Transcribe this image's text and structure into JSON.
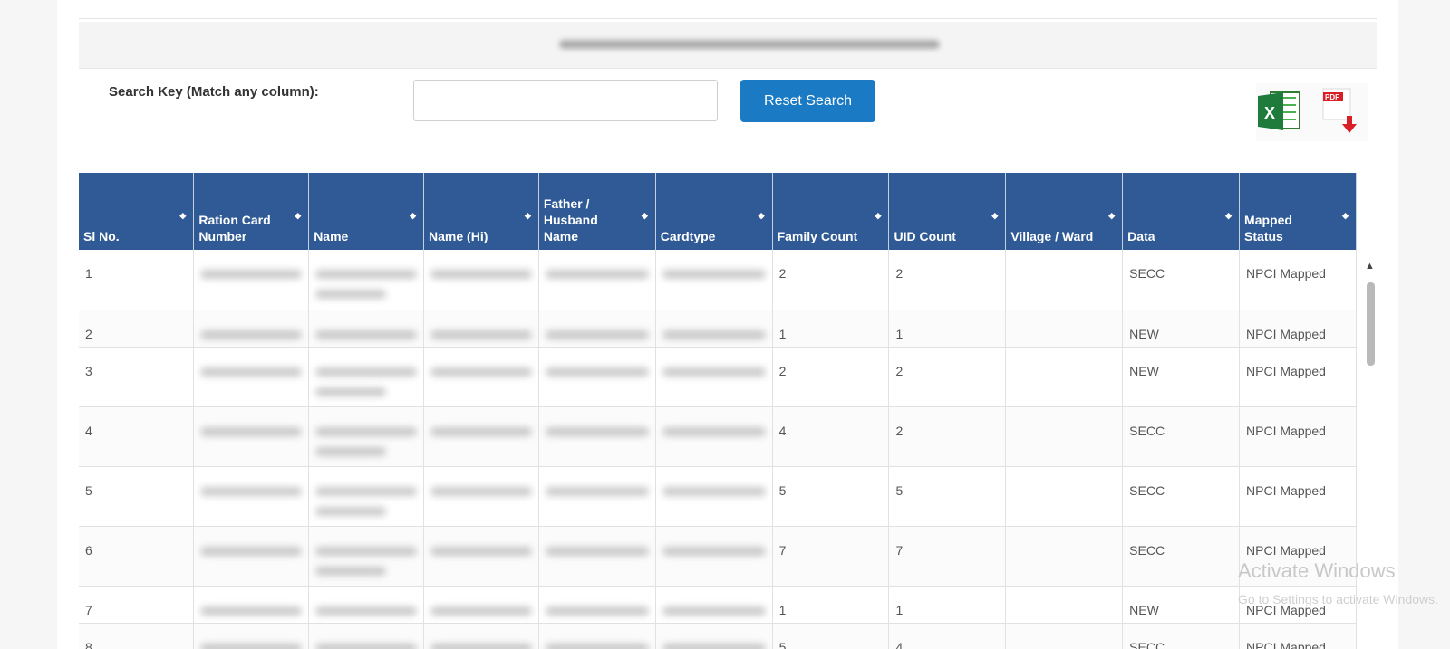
{
  "search": {
    "label": "Search Key (Match any column):",
    "value": "",
    "placeholder": "",
    "reset_label": "Reset Search"
  },
  "table": {
    "headers": [
      "Sl No.",
      "Ration Card Number",
      "Name",
      "Name (Hi)",
      "Father / Husband Name",
      "Cardtype",
      "Family Count",
      "UID Count",
      "Village / Ward",
      "Data",
      "Mapped Status"
    ],
    "rows": [
      {
        "sl": "1",
        "family": "2",
        "uid": "2",
        "village": "",
        "data": "SECC",
        "status": "NPCI Mapped"
      },
      {
        "sl": "2",
        "family": "1",
        "uid": "1",
        "village": "",
        "data": "NEW",
        "status": "NPCI Mapped"
      },
      {
        "sl": "3",
        "family": "2",
        "uid": "2",
        "village": "",
        "data": "NEW",
        "status": "NPCI Mapped"
      },
      {
        "sl": "4",
        "family": "4",
        "uid": "2",
        "village": "",
        "data": "SECC",
        "status": "NPCI Mapped"
      },
      {
        "sl": "5",
        "family": "5",
        "uid": "5",
        "village": "",
        "data": "SECC",
        "status": "NPCI Mapped"
      },
      {
        "sl": "6",
        "family": "7",
        "uid": "7",
        "village": "",
        "data": "SECC",
        "status": "NPCI Mapped"
      },
      {
        "sl": "7",
        "family": "1",
        "uid": "1",
        "village": "",
        "data": "NEW",
        "status": "NPCI Mapped"
      },
      {
        "sl": "8",
        "family": "5",
        "uid": "4",
        "village": "",
        "data": "SECC",
        "status": "NPCI Mapped"
      }
    ]
  },
  "icons": {
    "excel": "excel-export-icon",
    "pdf": "pdf-export-icon",
    "sort": "sort-icon"
  },
  "colors": {
    "header_bg": "#2f5a95",
    "button_bg": "#1a7bc4"
  },
  "watermark": {
    "line1": "Activate Windows",
    "line2": "Go to Settings to activate Windows."
  }
}
